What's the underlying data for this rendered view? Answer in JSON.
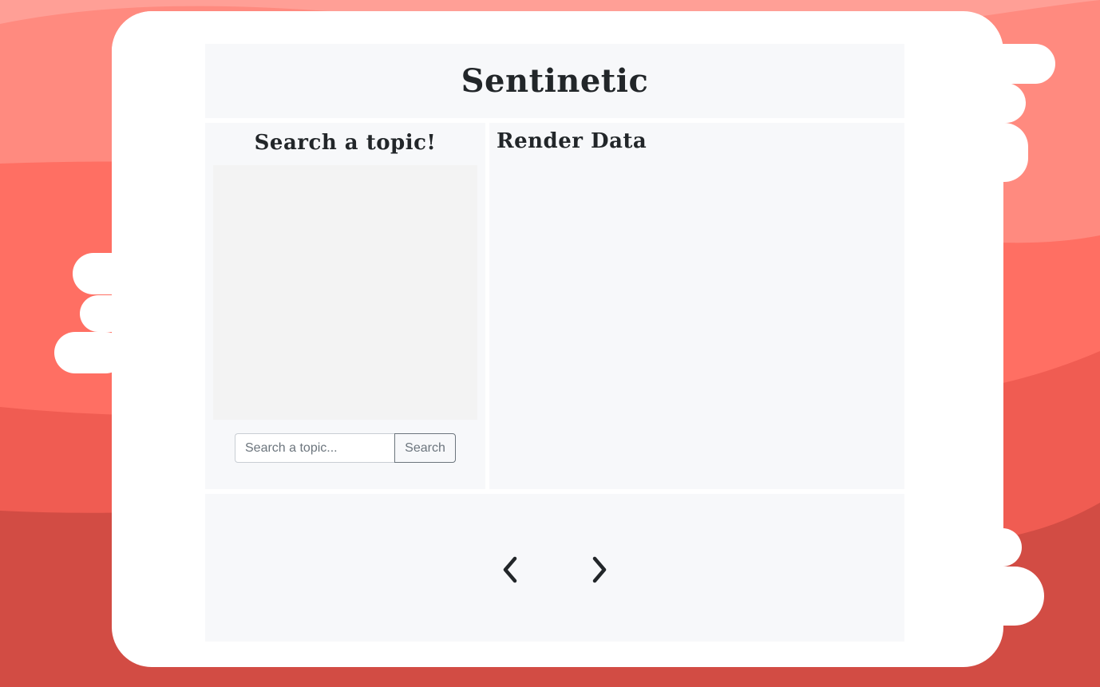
{
  "header": {
    "title": "Sentinetic"
  },
  "search_panel": {
    "title": "Search a topic!",
    "input_placeholder": "Search a topic...",
    "input_value": "",
    "button_label": "Search"
  },
  "render_panel": {
    "title": "Render Data"
  },
  "navigation": {
    "prev_icon": "chevron-left-icon",
    "next_icon": "chevron-right-icon"
  },
  "colors": {
    "background_light": "#ff9a90",
    "background_mid": "#ff6f63",
    "background_dark": "#d24c44",
    "card": "#ffffff",
    "panel": "#f7f8fa",
    "text": "#222629"
  }
}
